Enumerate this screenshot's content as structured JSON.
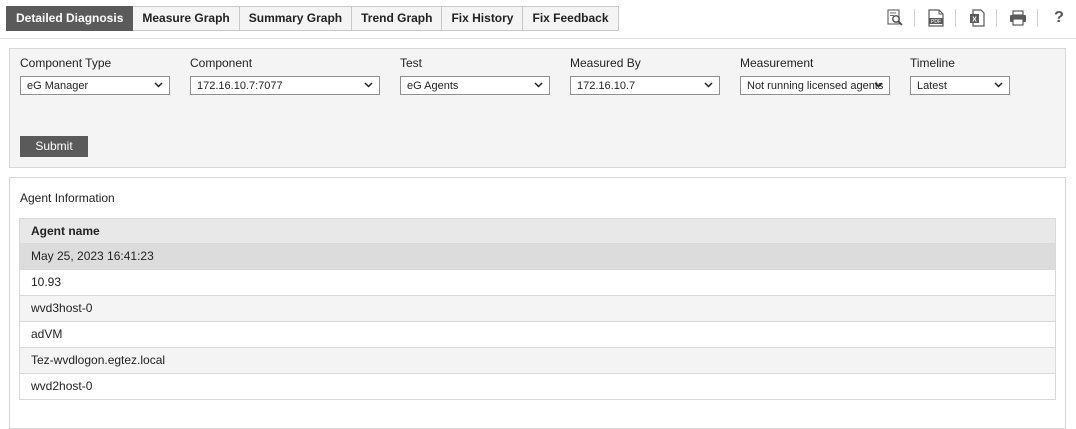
{
  "tabs": [
    {
      "label": "Detailed Diagnosis",
      "active": true
    },
    {
      "label": "Measure Graph"
    },
    {
      "label": "Summary Graph"
    },
    {
      "label": "Trend Graph"
    },
    {
      "label": "Fix History"
    },
    {
      "label": "Fix Feedback"
    }
  ],
  "toolbar": {
    "icons": [
      "search-report-icon",
      "pdf-icon",
      "excel-icon",
      "print-icon",
      "help-icon"
    ],
    "help_label": "?",
    "pdf_label": "PDF",
    "excel_label": "X"
  },
  "filters": {
    "component_type": {
      "label": "Component Type",
      "value": "eG Manager"
    },
    "component": {
      "label": "Component",
      "value": "172.16.10.7:7077"
    },
    "test": {
      "label": "Test",
      "value": "eG Agents"
    },
    "measured_by": {
      "label": "Measured By",
      "value": "172.16.10.7"
    },
    "measurement": {
      "label": "Measurement",
      "value": "Not running licensed agents"
    },
    "timeline": {
      "label": "Timeline",
      "value": "Latest"
    },
    "submit_label": "Submit"
  },
  "info": {
    "title": "Agent Information",
    "column_header": "Agent name",
    "timestamp": "May 25, 2023 16:41:23",
    "rows": [
      "10.93",
      "wvd3host-0",
      "adVM",
      "Tez-wvdlogon.egtez.local",
      "wvd2host-0"
    ]
  },
  "colors": {
    "active_tab": "#5a5a5a",
    "panel_bg": "#f4f4f4",
    "header_bg": "#e8e8e8",
    "submit_bg": "#5a5a5a"
  }
}
